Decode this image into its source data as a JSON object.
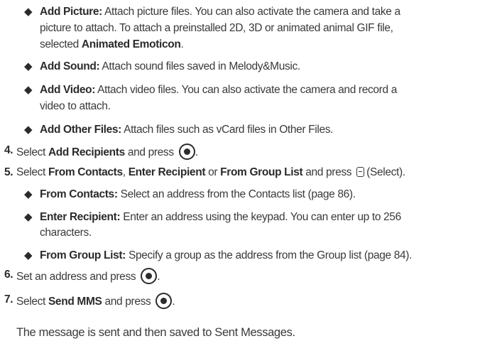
{
  "bullets_top": [
    {
      "term": "Add Picture:",
      "lines": [
        "Attach picture files. You can also activate the camera and take a",
        "picture to attach. To attach a preinstalled 2D, 3D or animated animal GIF file,"
      ],
      "line3_prefix": "selected ",
      "line3_bold": "Animated Emoticon",
      "line3_suffix": "."
    },
    {
      "term": "Add Sound:",
      "text": "Attach sound files saved in Melody&Music."
    },
    {
      "term": "Add Video:",
      "lines": [
        "Attach video files. You can also activate the camera and record a",
        "video to attach."
      ]
    },
    {
      "term": "Add Other Files:",
      "text": "Attach files such as vCard files in Other Files."
    }
  ],
  "step4": {
    "number": "4.",
    "pre": "Select ",
    "bold": "Add Recipients",
    "post": " and press "
  },
  "step5": {
    "number": "5.",
    "pre": "Select ",
    "bold1": "From Contacts",
    "sep1": ", ",
    "bold2": "Enter Recipient",
    "sep2": " or ",
    "bold3": "From Group List",
    "post": " and press ",
    "suffix": "(Select)."
  },
  "bullets_step5": [
    {
      "term": "From Contacts:",
      "text": "Select an address from the Contacts list (page 86)."
    },
    {
      "term": "Enter Recipient:",
      "lines": [
        "Enter an address using the keypad. You can enter up to 256",
        "characters."
      ]
    },
    {
      "term": "From Group List:",
      "text": "Specify a group as the address from the Group list (page 84)."
    }
  ],
  "step6": {
    "number": "6.",
    "text": "Set an address and press "
  },
  "step7": {
    "number": "7.",
    "pre": "Select ",
    "bold": "Send MMS",
    "post": " and press "
  },
  "final_note": "The message is sent and then saved to Sent Messages.",
  "glyphs": {
    "bullet": "◆",
    "trailing_period": "."
  },
  "icons": {
    "ok_key": "center-select-key-icon",
    "soft_key": "left-softkey-icon"
  },
  "colors": {
    "text": "#3a3a3a",
    "emphasis": "#2b2b2b",
    "background": "#ffffff"
  }
}
